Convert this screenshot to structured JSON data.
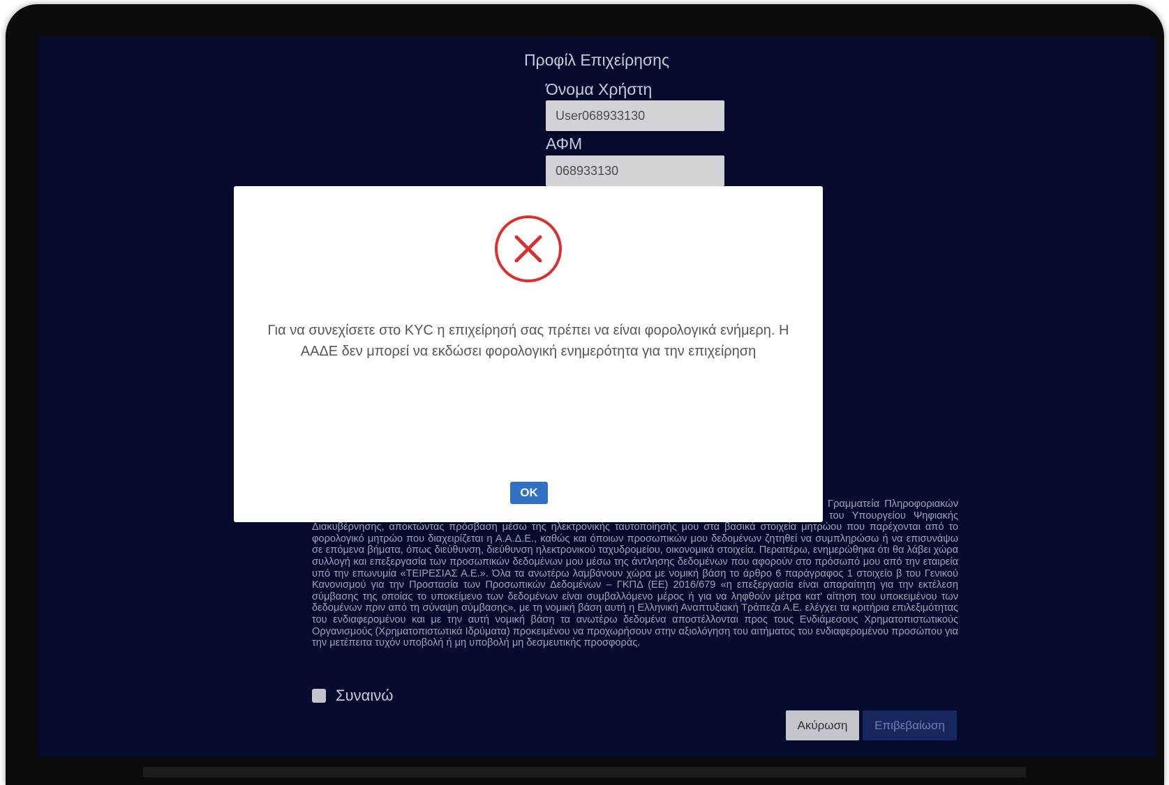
{
  "profile": {
    "title": "Προφίλ Επιχείρησης",
    "username_label": "Όνομα Χρήστη",
    "username_value": "User068933130",
    "vat_label": "ΑΦΜ",
    "vat_value": "068933130"
  },
  "consent": {
    "text": "Συναινώ στη συλλογή και επεξεργασία των προσωπικών δεδομένων μου, όπως συλλέγονται από τη Γενική Γραμματεία Πληροφοριακών Συστημάτων του Υπουργείου Ψηφιακής Διακυβέρνησης μέσω του Κέντρου Διαλειτουργικότητας (ΚΕ.Δ.) του Υπουργείου Ψηφιακής Διακυβέρνησης, αποκτώντας πρόσβαση μέσω της ηλεκτρονικής ταυτοποίησής μου στα βασικά στοιχεία μητρώου που παρέχονται από το φορολογικό μητρώο που διαχειρίζεται η Α.Α.Δ.Ε., καθώς και όποιων προσωπικών μου δεδομένων ζητηθεί να συμπληρώσω ή να επισυνάψω σε επόμενα βήματα, όπως διεύθυνση, διεύθυνση ηλεκτρονικού ταχυδρομείου, οικονομικά στοιχεία. Περαιτέρω, ενημερώθηκα ότι θα λάβει χώρα συλλογή και επεξεργασία των προσωπικών δεδομένων μου μέσω της άντλησης δεδομένων που αφορούν στο πρόσωπό μου από την εταιρεία υπό την επωνυμία «ΤΕΙΡΕΣΙΑΣ Α.Ε.». Όλα τα ανωτέρω λαμβάνουν χώρα με νομική βάση το άρθρο 6 παράγραφος 1 στοιχείο β του Γενικού Κανονισμού για την Προστασία των Προσωπικών Δεδομένων – ΓΚΠΔ (ΕΕ) 2016/679 «η επεξεργασία είναι απαραίτητη για την εκτέλεση σύμβασης της οποίας το υποκείμενο των δεδομένων είναι συμβαλλόμενο μέρος ή για να ληφθούν μέτρα κατ' αίτηση του υποκειμένου των δεδομένων πριν από τη σύναψη σύμβασης», με τη νομική βάση αυτή η Ελληνική Αναπτυξιακή Τράπεζα Α.Ε. ελέγχει τα κριτήρια επιλεξιμότητας του ενδιαφερομένου και με την αυτή νομική βάση τα ανωτέρω δεδομένα αποστέλλονται προς τους Ενδιάμεσους Χρηματοπιστωτικούς Οργανισμούς (Χρηματοπιστωτικά Ιδρύματα) προκειμένου να προχωρήσουν στην αξιολόγηση του αιτήματος του ενδιαφερομένου προσώπου για την μετέπειτα τυχόν υποβολή ή μη υποβολή μη δεσμευτικής προσφοράς.",
    "agree_label": "Συναινώ",
    "agree_checked": false
  },
  "actions": {
    "cancel_label": "Ακύρωση",
    "confirm_label": "Επιβεβαίωση"
  },
  "modal": {
    "icon": "error-x-circle-icon",
    "message_line1": "Για να συνεχίσετε στο KYC η επιχείρησή σας πρέπει να είναι φορολογικά ενήμερη. Η",
    "message_line2": "ΑΑΔΕ δεν μπορεί να εκδώσει φορολογική ενημερότητα για την επιχείρηση",
    "ok_label": "OK"
  },
  "colors": {
    "background": "#050b2c",
    "error_red": "#d9302f",
    "ok_blue": "#2f6fc4",
    "confirm_disabled": "#16275f"
  }
}
